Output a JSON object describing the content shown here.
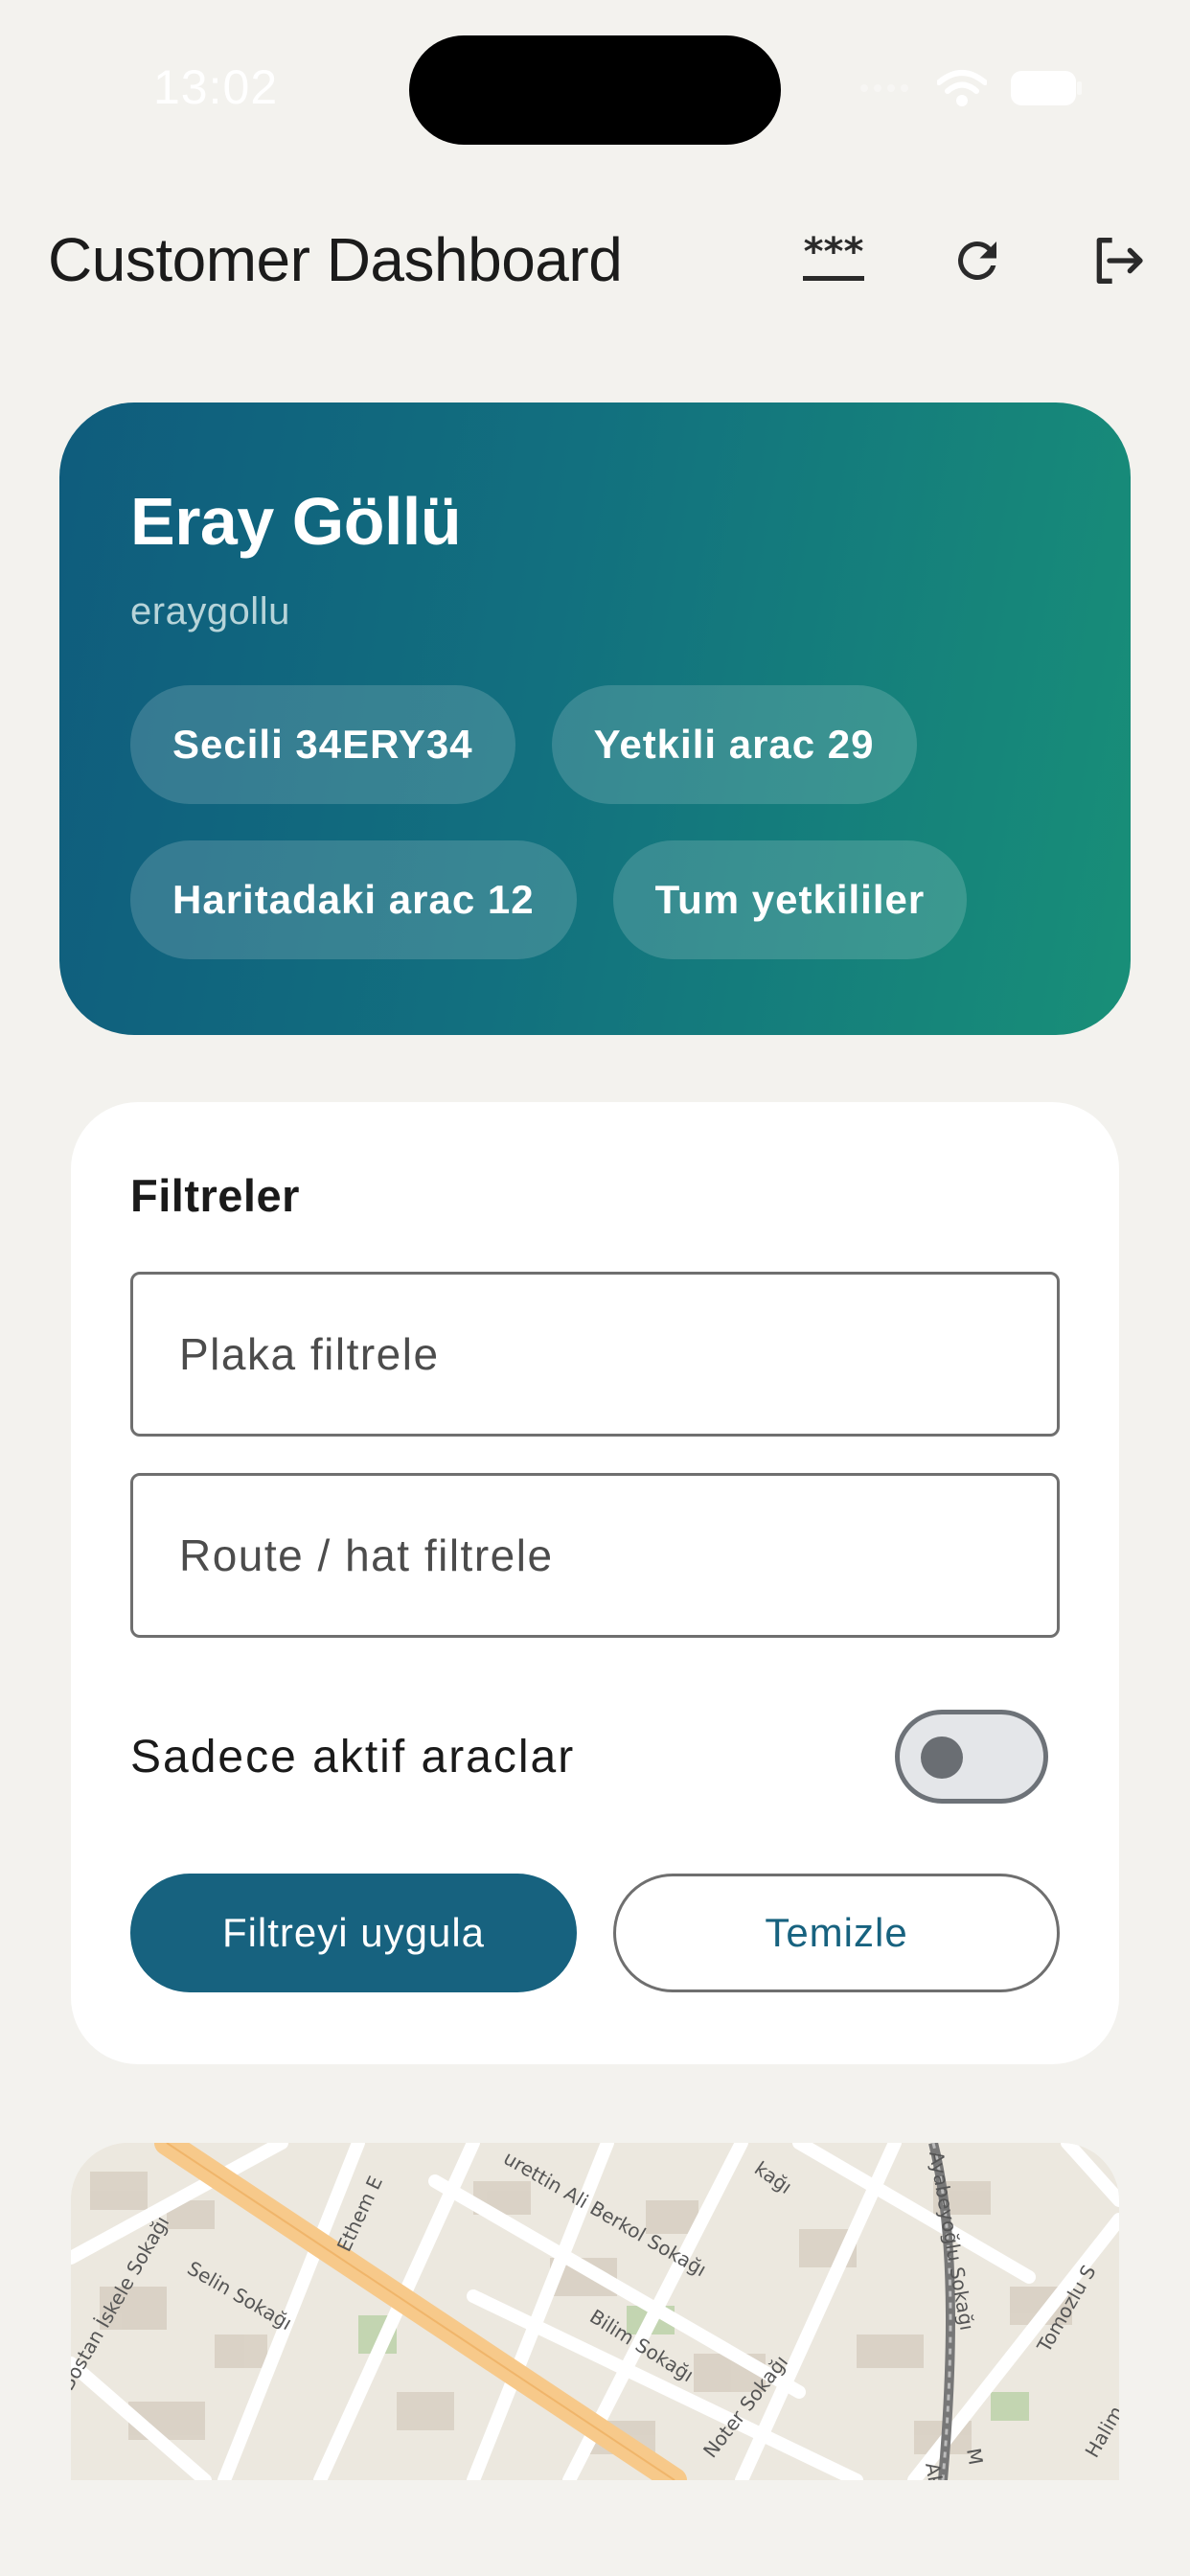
{
  "status_bar": {
    "time": "13:02"
  },
  "header": {
    "title": "Customer Dashboard",
    "password_icon": "***"
  },
  "profile": {
    "name": "Eray Göllü",
    "username": "eraygollu",
    "chips": [
      {
        "label": "Secili 34ERY34"
      },
      {
        "label": "Yetkili arac 29"
      },
      {
        "label": "Haritadaki arac 12"
      },
      {
        "label": "Tum yetkililer"
      }
    ]
  },
  "filters": {
    "title": "Filtreler",
    "plate_placeholder": "Plaka filtrele",
    "plate_value": "",
    "route_placeholder": "Route / hat filtrele",
    "route_value": "",
    "active_only_label": "Sadece aktif araclar",
    "active_only": false,
    "apply_label": "Filtreyi uygula",
    "clear_label": "Temizle"
  },
  "map": {
    "street_labels": [
      "Bostan İskele Sokağı",
      "Selin Sokağı",
      "Ethem E",
      "urettin Ali Berkol Sokağı",
      "Bilim Sokağı",
      "Noter Sokağı",
      "Ayabeyoğlu Sokağı",
      "Tomozlu S",
      "Halim",
      "kağı",
      "Ak",
      "M"
    ]
  },
  "colors": {
    "card_gradient_start": "#0f5c7d",
    "card_gradient_end": "#188f78",
    "primary": "#17627f",
    "background": "#f3f2ee"
  }
}
